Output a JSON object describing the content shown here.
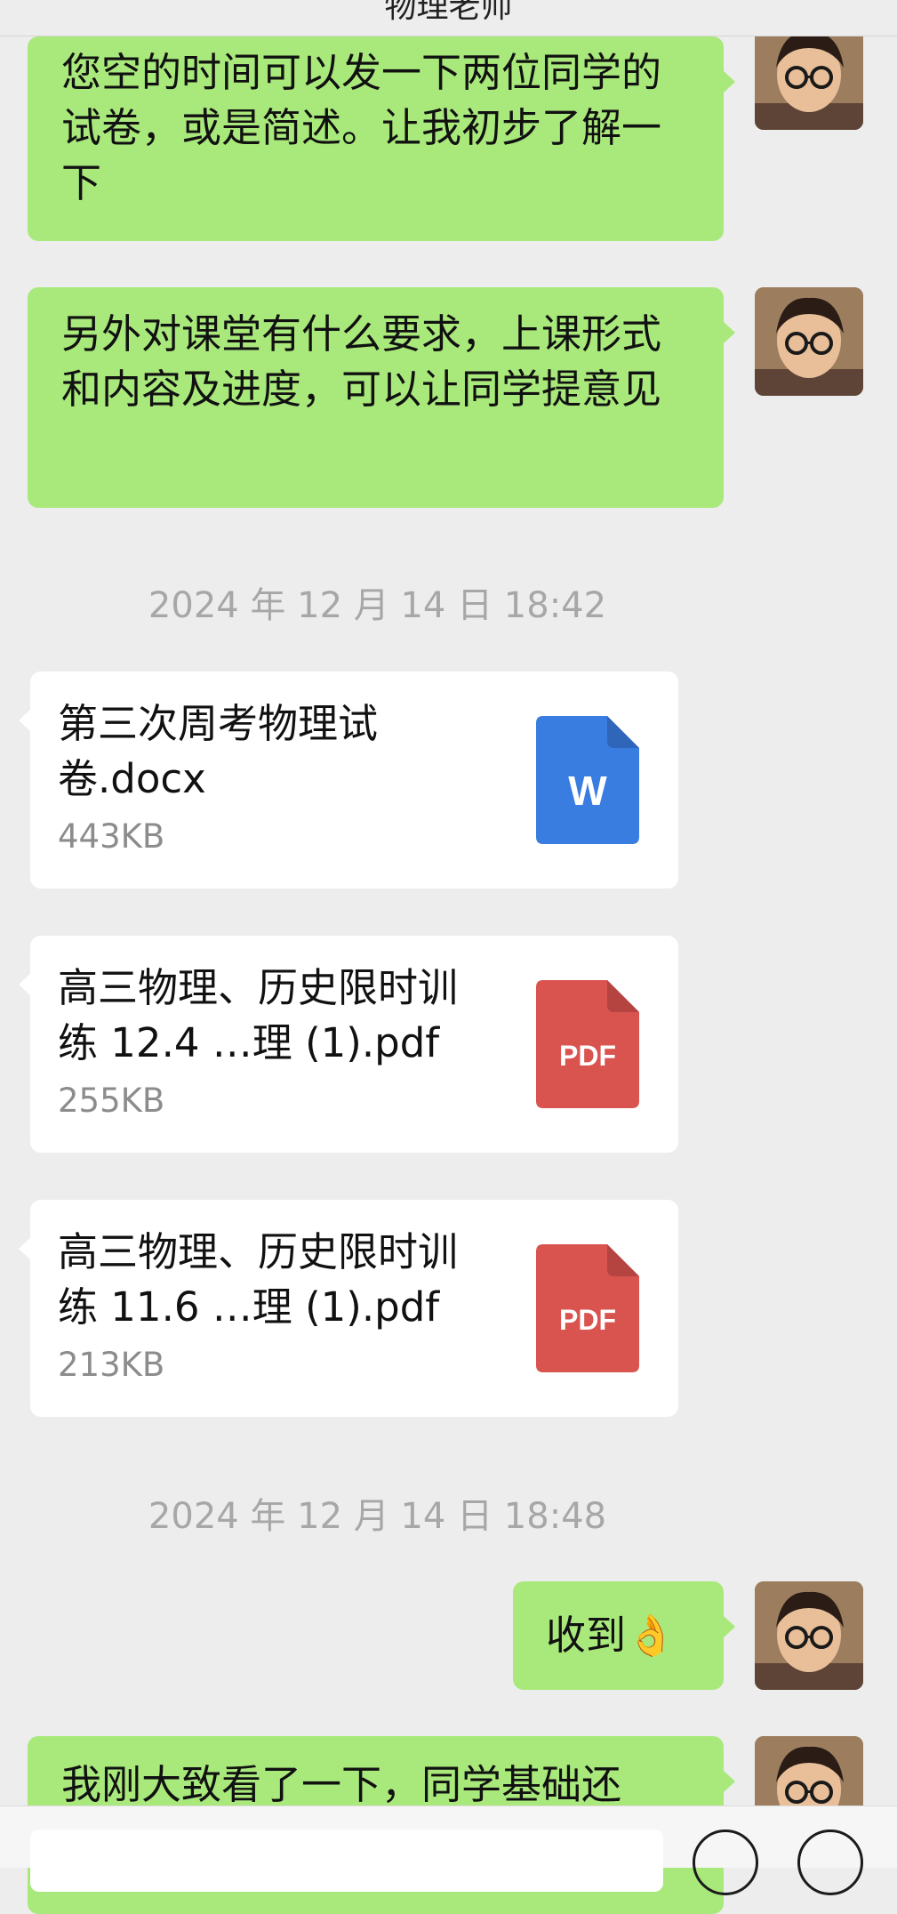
{
  "header": {
    "title": "物理老师"
  },
  "messages": [
    {
      "text": "您空的时间可以发一下两位同学的试卷，或是简述。让我初步了解一下"
    },
    {
      "text": "另外对课堂有什么要求，上课形式和内容及进度，可以让同学提意见"
    }
  ],
  "timestamps": [
    "2024 年 12 月 14 日 18:42",
    "2024 年 12 月 14 日 18:48"
  ],
  "files": [
    {
      "name": "第三次周考物理试卷.docx",
      "size": "443KB",
      "icon_label": "W",
      "icon_color": "#3a7de0",
      "icon_fold": "#2f66ba",
      "icon": "word-file-icon"
    },
    {
      "name": "高三物理、历史限时训练 12.4 …理 (1).pdf",
      "size": "255KB",
      "icon_label": "PDF",
      "icon_color": "#d9534f",
      "icon_fold": "#b54440",
      "icon": "pdf-file-icon"
    },
    {
      "name": "高三物理、历史限时训练 11.6 …理 (1).pdf",
      "size": "213KB",
      "icon_label": "PDF",
      "icon_color": "#d9534f",
      "icon_fold": "#b54440",
      "icon": "pdf-file-icon"
    }
  ],
  "reply": {
    "text": "收到",
    "emoji": "👌"
  },
  "last_message": {
    "text": "我刚大致看了一下，同学基础还"
  },
  "colors": {
    "green_bubble": "#a9e97c",
    "background": "#ededed",
    "card": "#ffffff"
  }
}
